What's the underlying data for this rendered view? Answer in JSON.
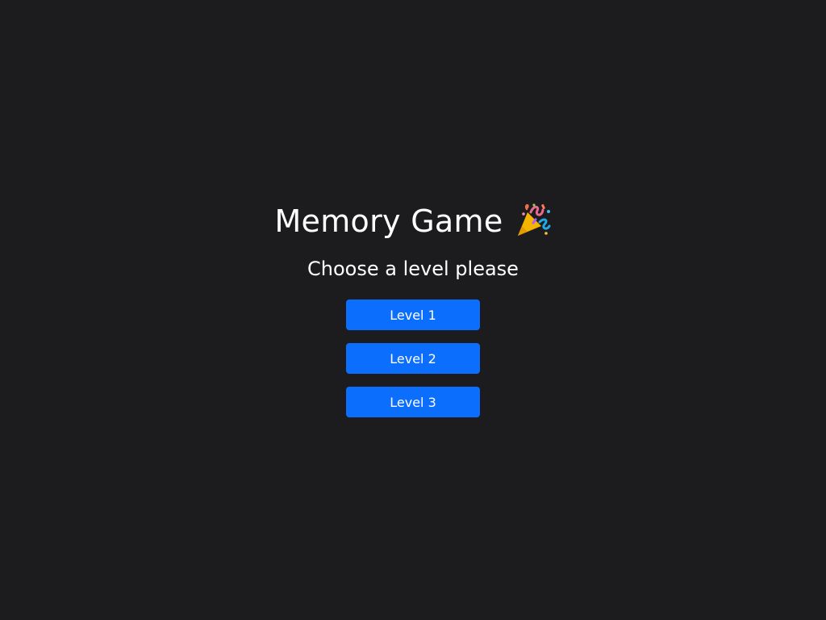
{
  "game": {
    "title": "Memory Game",
    "title_icon": "party-popper-icon",
    "subtitle": "Choose a level please"
  },
  "levels": [
    {
      "label": "Level 1"
    },
    {
      "label": "Level 2"
    },
    {
      "label": "Level 3"
    }
  ],
  "colors": {
    "background": "#1c1c1e",
    "text": "#ffffff",
    "button": "#0b6efd",
    "button_text": "#ffffff"
  }
}
